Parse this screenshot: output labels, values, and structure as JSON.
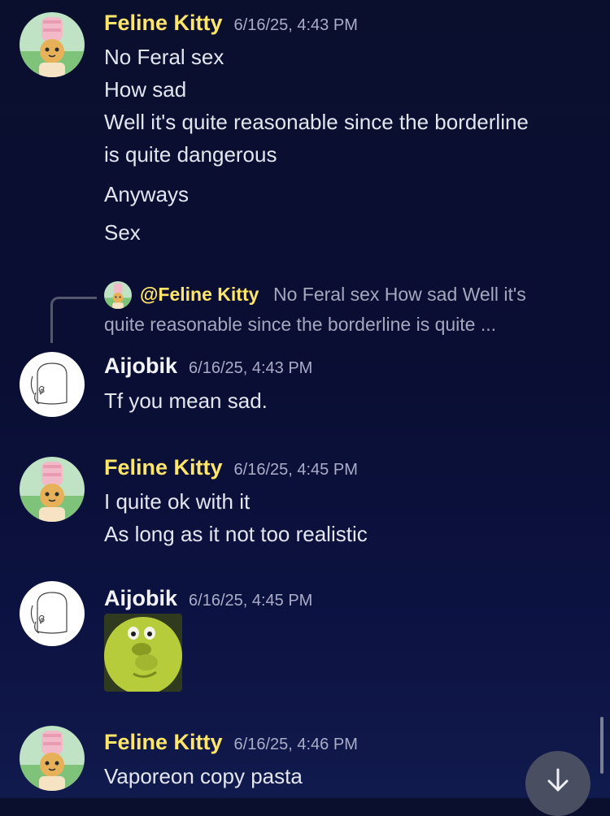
{
  "messages": [
    {
      "username": "Feline Kitty",
      "timestamp": "6/16/25, 4:43 PM",
      "lines": [
        "No Feral sex",
        "How sad",
        "Well it's quite reasonable since the borderline",
        "is quite dangerous",
        "Anyways",
        "Sex"
      ]
    },
    {
      "reply": {
        "username": "@Feline Kitty",
        "text_line1": "No Feral sex How sad Well it's",
        "text_line2": "quite reasonable since the borderline is quite ..."
      },
      "username": "Aijobik",
      "timestamp": "6/16/25, 4:43 PM",
      "lines": [
        "Tf you mean sad."
      ]
    },
    {
      "username": "Feline Kitty",
      "timestamp": "6/16/25, 4:45 PM",
      "lines": [
        "I quite ok with it",
        "As long as it not too realistic"
      ]
    },
    {
      "username": "Aijobik",
      "timestamp": "6/16/25, 4:45 PM",
      "sticker": "green-cartoon-face-sticker"
    },
    {
      "username": "Feline Kitty",
      "timestamp": "6/16/25, 4:46 PM",
      "lines": [
        "Vaporeon copy pasta"
      ]
    }
  ],
  "icons": {
    "jump": "arrow-down-icon"
  },
  "colors": {
    "kitty_name": "#ffe66a",
    "aijobik_name": "#f2f3f8",
    "timestamp": "#a9adc7",
    "text": "#e4e6ef"
  }
}
